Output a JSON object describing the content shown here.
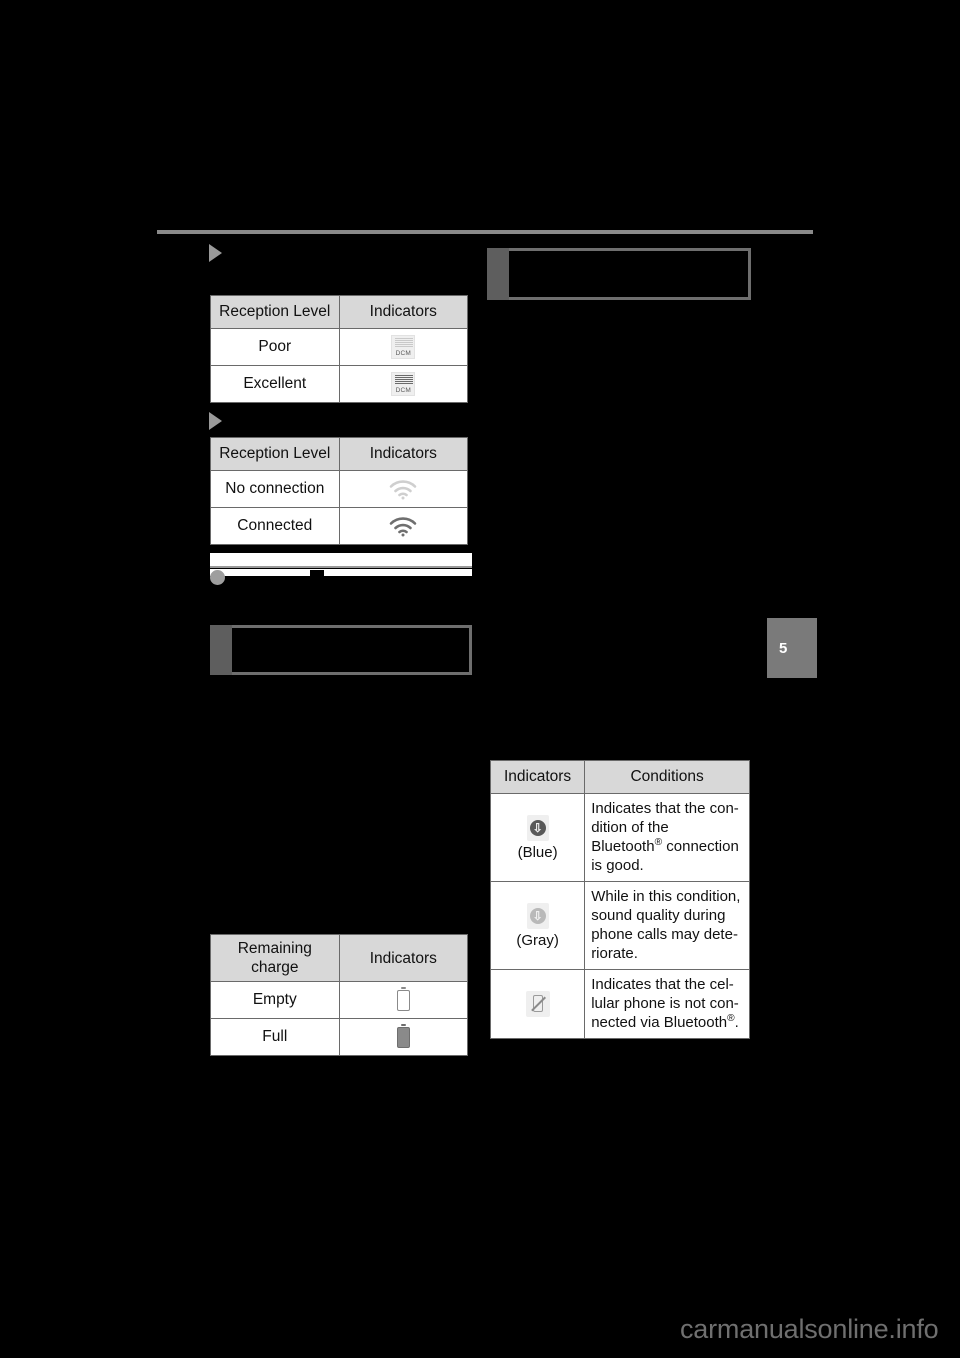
{
  "page": {
    "chapter_marker": "5",
    "watermark": "carmanualsonline.info"
  },
  "tables": {
    "dcm_reception": {
      "headers": [
        "Reception Level",
        "Indicators"
      ],
      "rows": [
        {
          "level": "Poor",
          "icon": "dcm-signal-poor-icon"
        },
        {
          "level": "Excellent",
          "icon": "dcm-signal-excellent-icon"
        }
      ]
    },
    "wifi_reception": {
      "headers": [
        "Reception Level",
        "Indicators"
      ],
      "rows": [
        {
          "level": "No connection",
          "icon": "wifi-no-connection-icon"
        },
        {
          "level": "Connected",
          "icon": "wifi-connected-icon"
        }
      ]
    },
    "battery_charge": {
      "headers": [
        "Remaining charge",
        "Indicators"
      ],
      "header_line_1": "Remaining",
      "header_line_2": "charge",
      "rows": [
        {
          "level": "Empty",
          "icon": "battery-empty-icon"
        },
        {
          "level": "Full",
          "icon": "battery-full-icon"
        }
      ]
    },
    "bluetooth_status": {
      "headers": [
        "Indicators",
        "Conditions"
      ],
      "rows": [
        {
          "icon": "bluetooth-blue-icon",
          "icon_label": "(Blue)",
          "condition_part1": "Indicates that the con-dition of the ",
          "condition_brand": "Bluetooth",
          "condition_sup": "®",
          "condition_part2": " connection is good."
        },
        {
          "icon": "bluetooth-gray-icon",
          "icon_label": "(Gray)",
          "condition_plain": "While in this condition, sound quality during phone calls may dete-riorate."
        },
        {
          "icon": "phone-not-connected-icon",
          "icon_label": "",
          "condition_part1": "Indicates that the cel-lular phone is not con-nected via ",
          "condition_brand": "Bluetooth",
          "condition_sup": "®",
          "condition_part2": "."
        }
      ]
    }
  },
  "colors": {
    "rule": "#8a8a8a",
    "table_header_bg": "#d8d8d8",
    "table_border": "#6a6a6a",
    "note_border": "#6e6e6e",
    "note_tab": "#5e5e5e",
    "chapter_tab": "#7a7a7a",
    "bullet": "#9a9a9a",
    "watermark": "#6f6f6f",
    "page_bg": "#000000"
  }
}
